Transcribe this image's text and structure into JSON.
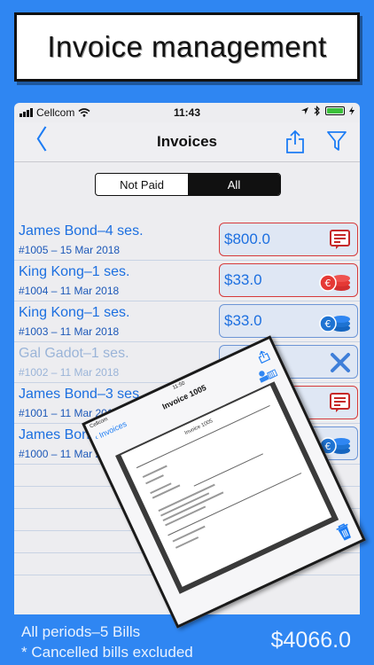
{
  "banner": {
    "title": "Invoice management"
  },
  "status_bar": {
    "carrier": "Cellcom",
    "time": "11:43"
  },
  "nav": {
    "back_glyph": "〈",
    "title": "Invoices"
  },
  "segments": [
    {
      "label": "Not Paid",
      "active": false
    },
    {
      "label": "All",
      "active": true
    }
  ],
  "invoices": [
    {
      "name": "James Bond–4 ses.",
      "sub": "#1005 – 15 Mar 2018",
      "amount": "$800.0",
      "icon": "invoice-icon",
      "status": "unpaid"
    },
    {
      "name": "King Kong–1 ses.",
      "sub": "#1004 – 11 Mar 2018",
      "amount": "$33.0",
      "icon": "coins-icon",
      "status": "unpaid"
    },
    {
      "name": "King Kong–1 ses.",
      "sub": "#1003 – 11 Mar 2018",
      "amount": "$33.0",
      "icon": "coins-icon",
      "status": "paid"
    },
    {
      "name": "Gal Gadot–1 ses.",
      "sub": "#1002 – 11 Mar 2018",
      "amount": "",
      "icon": "cancel-x-icon",
      "status": "cancelled"
    },
    {
      "name": "James Bond–3 ses.",
      "sub": "#1001 – 11 Mar 2018",
      "amount": "",
      "icon": "invoice-icon",
      "status": "unpaid"
    },
    {
      "name": "James Bond–4 ses.",
      "sub": "#1000 – 11 Mar 2018",
      "amount": "",
      "icon": "coins-icon",
      "status": "paid"
    }
  ],
  "footer": {
    "periods": "All periods–5 Bills",
    "note": "* Cancelled bills excluded",
    "total": "$4066.0"
  },
  "overlay": {
    "carrier": "Cellcom",
    "time": "11:50",
    "back_label": "Invoices",
    "title": "Invoice 1005",
    "doc_title": "Invoice 1005"
  },
  "colors": {
    "accent": "#1c7cf4",
    "background": "#2f86f2",
    "unpaid_border": "#d63a3a",
    "paid_border": "#6c95d6"
  }
}
